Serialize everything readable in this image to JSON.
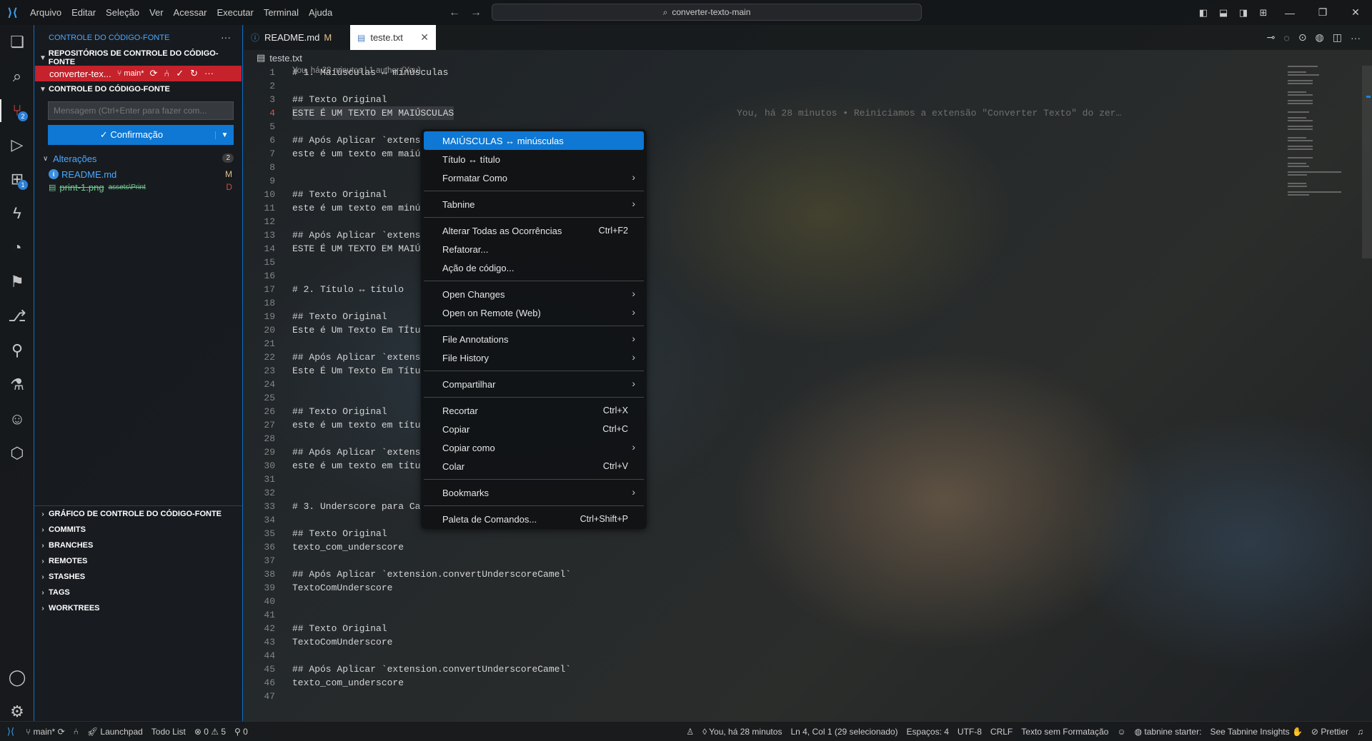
{
  "menu": [
    "Arquivo",
    "Editar",
    "Seleção",
    "Ver",
    "Acessar",
    "Executar",
    "Terminal",
    "Ajuda"
  ],
  "command_center": "converter-texto-main",
  "sidebar": {
    "title": "CONTROLE DO CÓDIGO-FONTE",
    "repos_header": "REPOSITÓRIOS DE CONTROLE DO CÓDIGO-FONTE",
    "repo_name": "converter-tex...",
    "repo_branch": "main*",
    "scm_header": "CONTROLE DO CÓDIGO-FONTE",
    "message_placeholder": "Mensagem (Ctrl+Enter para fazer com...",
    "commit_label": "Confirmação",
    "changes_label": "Alterações",
    "changes_count": "2",
    "files": [
      {
        "name": "README.md",
        "path": "",
        "status": "M"
      },
      {
        "name": "print-1.png",
        "path": "assets\\Print",
        "status": "D"
      }
    ],
    "bottom_sections": [
      "GRÁFICO DE CONTROLE DO CÓDIGO-FONTE",
      "COMMITS",
      "BRANCHES",
      "REMOTES",
      "STASHES",
      "TAGS",
      "WORKTREES"
    ],
    "activity_badges": {
      "scm": "2",
      "extensions": "1"
    }
  },
  "tabs": [
    {
      "label": "README.md",
      "modified": "M"
    },
    {
      "label": "teste.txt"
    }
  ],
  "breadcrumb": "teste.txt",
  "editor": {
    "codelens": "You, há 28 minutos | 1 author (You)",
    "blame": "You, há 28 minutos • Reiniciamos a extensão \"Converter Texto\" do zer…",
    "lines": [
      {
        "n": "1",
        "t": "# 1. Maiúsculas ↔ minúsculas"
      },
      {
        "n": "2",
        "t": ""
      },
      {
        "n": "3",
        "t": "## Texto Original"
      },
      {
        "n": "4",
        "t": "ESTE É UM TEXTO EM MAIÚSCULAS"
      },
      {
        "n": "5",
        "t": ""
      },
      {
        "n": "6",
        "t": "## Após Aplicar `extens"
      },
      {
        "n": "7",
        "t": "este é um texto em maiú"
      },
      {
        "n": "8",
        "t": ""
      },
      {
        "n": "9",
        "t": ""
      },
      {
        "n": "10",
        "t": "## Texto Original"
      },
      {
        "n": "11",
        "t": "este é um texto em minú"
      },
      {
        "n": "12",
        "t": ""
      },
      {
        "n": "13",
        "t": "## Após Aplicar `extens"
      },
      {
        "n": "14",
        "t": "ESTE É UM TEXTO EM MAIÚ"
      },
      {
        "n": "15",
        "t": ""
      },
      {
        "n": "16",
        "t": ""
      },
      {
        "n": "17",
        "t": "# 2. Título ↔ título"
      },
      {
        "n": "18",
        "t": ""
      },
      {
        "n": "19",
        "t": "## Texto Original"
      },
      {
        "n": "20",
        "t": "Este é Um Texto Em TÍtu"
      },
      {
        "n": "21",
        "t": ""
      },
      {
        "n": "22",
        "t": "## Após Aplicar `extens"
      },
      {
        "n": "23",
        "t": "Este É Um Texto Em Títu"
      },
      {
        "n": "24",
        "t": ""
      },
      {
        "n": "25",
        "t": ""
      },
      {
        "n": "26",
        "t": "## Texto Original"
      },
      {
        "n": "27",
        "t": "este é um texto em títu"
      },
      {
        "n": "28",
        "t": ""
      },
      {
        "n": "29",
        "t": "## Após Aplicar `extens"
      },
      {
        "n": "30",
        "t": "este é um texto em títu"
      },
      {
        "n": "31",
        "t": ""
      },
      {
        "n": "32",
        "t": ""
      },
      {
        "n": "33",
        "t": "# 3. Underscore para Ca"
      },
      {
        "n": "34",
        "t": ""
      },
      {
        "n": "35",
        "t": "## Texto Original"
      },
      {
        "n": "36",
        "t": "texto_com_underscore"
      },
      {
        "n": "37",
        "t": ""
      },
      {
        "n": "38",
        "t": "## Após Aplicar `extension.convertUnderscoreCamel`"
      },
      {
        "n": "39",
        "t": "TextoComUnderscore"
      },
      {
        "n": "40",
        "t": ""
      },
      {
        "n": "41",
        "t": ""
      },
      {
        "n": "42",
        "t": "## Texto Original"
      },
      {
        "n": "43",
        "t": "TextoComUnderscore"
      },
      {
        "n": "44",
        "t": ""
      },
      {
        "n": "45",
        "t": "## Após Aplicar `extension.convertUnderscoreCamel`"
      },
      {
        "n": "46",
        "t": "texto_com_underscore"
      },
      {
        "n": "47",
        "t": ""
      }
    ]
  },
  "context_menu": {
    "groups": [
      [
        {
          "label": "MAIÚSCULAS ↔ minúsculas",
          "key": "",
          "submenu": false,
          "highlighted": true
        },
        {
          "label": "Título ↔ título",
          "key": "",
          "submenu": false
        },
        {
          "label": "Formatar Como",
          "key": "",
          "submenu": true
        }
      ],
      [
        {
          "label": "Tabnine",
          "key": "",
          "submenu": true
        }
      ],
      [
        {
          "label": "Alterar Todas as Ocorrências",
          "key": "Ctrl+F2",
          "submenu": false
        },
        {
          "label": "Refatorar...",
          "key": "",
          "submenu": false
        },
        {
          "label": "Ação de código...",
          "key": "",
          "submenu": false
        }
      ],
      [
        {
          "label": "Open Changes",
          "key": "",
          "submenu": true
        },
        {
          "label": "Open on Remote (Web)",
          "key": "",
          "submenu": true
        }
      ],
      [
        {
          "label": "File Annotations",
          "key": "",
          "submenu": true
        },
        {
          "label": "File History",
          "key": "",
          "submenu": true
        }
      ],
      [
        {
          "label": "Compartilhar",
          "key": "",
          "submenu": true
        }
      ],
      [
        {
          "label": "Recortar",
          "key": "Ctrl+X",
          "submenu": false
        },
        {
          "label": "Copiar",
          "key": "Ctrl+C",
          "submenu": false
        },
        {
          "label": "Copiar como",
          "key": "",
          "submenu": true
        },
        {
          "label": "Colar",
          "key": "Ctrl+V",
          "submenu": false
        }
      ],
      [
        {
          "label": "Bookmarks",
          "key": "",
          "submenu": true
        }
      ],
      [
        {
          "label": "Paleta de Comandos...",
          "key": "Ctrl+Shift+P",
          "submenu": false
        }
      ]
    ]
  },
  "statusbar": {
    "branch": "main*",
    "launchpad": "Launchpad",
    "todo": "Todo List",
    "errors": "0",
    "warnings": "5",
    "ports": "0",
    "blame": "You, há 28 minutos",
    "position": "Ln 4, Col 1 (29 selecionado)",
    "spaces": "Espaços: 4",
    "encoding": "UTF-8",
    "eol": "CRLF",
    "language": "Texto sem Formatação",
    "tabnine": "tabnine starter:",
    "tabnine_insights": "See Tabnine Insights",
    "prettier": "Prettier"
  },
  "colors": {
    "accent": "#0e78d4",
    "repo_highlight": "#c5222b",
    "modified": "#e2c08d",
    "deleted": "#c74e39",
    "added_file": "#73c991"
  }
}
